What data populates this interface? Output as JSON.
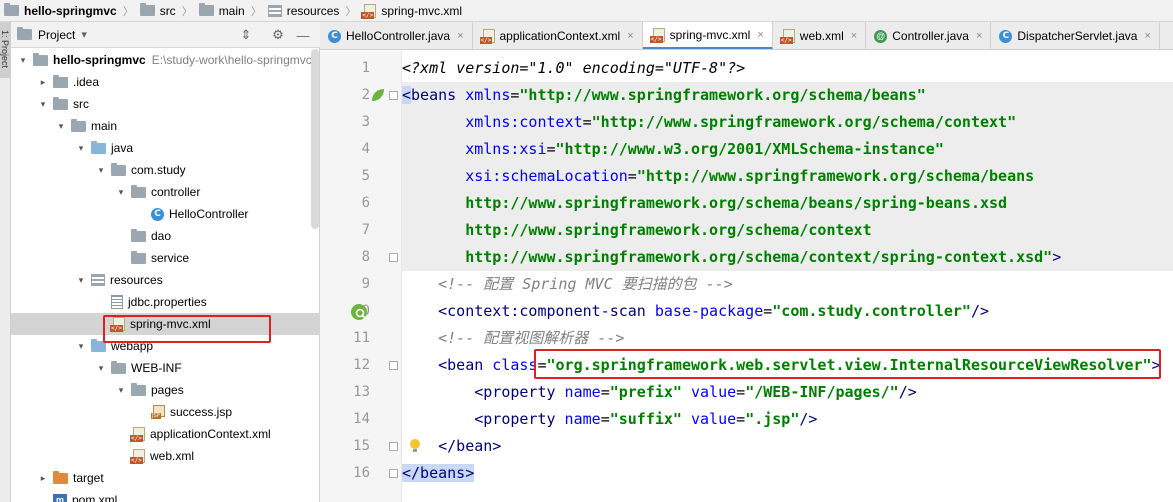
{
  "breadcrumb": [
    {
      "label": "hello-springmvc",
      "icon": "folder-icon"
    },
    {
      "label": "src",
      "icon": "folder-icon"
    },
    {
      "label": "main",
      "icon": "folder-icon"
    },
    {
      "label": "resources",
      "icon": "resources-folder-icon"
    },
    {
      "label": "spring-mvc.xml",
      "icon": "xml-file-icon"
    }
  ],
  "left_stripe": {
    "label": "1: Project"
  },
  "project_panel": {
    "title": "Project",
    "dropdown_glyph": "▾",
    "toolbar_glyphs": {
      "collapse": "⇕",
      "settings": "⚙",
      "hide": "—"
    },
    "tree": [
      {
        "label": "hello-springmvc",
        "path": "E:\\study-work\\hello-springmvc",
        "depth": 0,
        "arrow": "expanded",
        "icon": "module-folder-icon",
        "bold": true
      },
      {
        "label": ".idea",
        "depth": 1,
        "arrow": "collapsed",
        "icon": "folder-icon"
      },
      {
        "label": "src",
        "depth": 1,
        "arrow": "expanded",
        "icon": "folder-icon"
      },
      {
        "label": "main",
        "depth": 2,
        "arrow": "expanded",
        "icon": "folder-icon"
      },
      {
        "label": "java",
        "depth": 3,
        "arrow": "expanded",
        "icon": "source-folder-icon"
      },
      {
        "label": "com.study",
        "depth": 4,
        "arrow": "expanded",
        "icon": "package-icon"
      },
      {
        "label": "controller",
        "depth": 5,
        "arrow": "expanded",
        "icon": "package-icon"
      },
      {
        "label": "HelloController",
        "depth": 6,
        "arrow": "none",
        "icon": "java-class-icon"
      },
      {
        "label": "dao",
        "depth": 5,
        "arrow": "none",
        "icon": "package-icon"
      },
      {
        "label": "service",
        "depth": 5,
        "arrow": "none",
        "icon": "package-icon"
      },
      {
        "label": "resources",
        "depth": 3,
        "arrow": "expanded",
        "icon": "resources-folder-icon"
      },
      {
        "label": "jdbc.properties",
        "depth": 4,
        "arrow": "none",
        "icon": "properties-file-icon"
      },
      {
        "label": "spring-mvc.xml",
        "depth": 4,
        "arrow": "none",
        "icon": "xml-file-icon",
        "selected": true
      },
      {
        "label": "webapp",
        "depth": 3,
        "arrow": "expanded",
        "icon": "web-folder-icon"
      },
      {
        "label": "WEB-INF",
        "depth": 4,
        "arrow": "expanded",
        "icon": "folder-icon"
      },
      {
        "label": "pages",
        "depth": 5,
        "arrow": "expanded",
        "icon": "folder-icon"
      },
      {
        "label": "success.jsp",
        "depth": 6,
        "arrow": "none",
        "icon": "jsp-file-icon"
      },
      {
        "label": "applicationContext.xml",
        "depth": 5,
        "arrow": "none",
        "icon": "xml-file-icon"
      },
      {
        "label": "web.xml",
        "depth": 5,
        "arrow": "none",
        "icon": "xml-file-icon"
      },
      {
        "label": "target",
        "depth": 1,
        "arrow": "collapsed",
        "icon": "excluded-folder-icon"
      },
      {
        "label": "pom.xml",
        "depth": 1,
        "arrow": "none",
        "icon": "maven-file-icon"
      }
    ]
  },
  "tabs": [
    {
      "label": "HelloController.java",
      "icon": "java-class-icon",
      "active": false
    },
    {
      "label": "applicationContext.xml",
      "icon": "xml-file-icon",
      "active": false
    },
    {
      "label": "spring-mvc.xml",
      "icon": "xml-file-icon",
      "active": true
    },
    {
      "label": "web.xml",
      "icon": "xml-file-icon",
      "active": false
    },
    {
      "label": "Controller.java",
      "icon": "annotation-icon",
      "active": false
    },
    {
      "label": "DispatcherServlet.java",
      "icon": "java-class-icon",
      "active": false
    }
  ],
  "tab_close_glyph": "×",
  "code_lines": [
    {
      "n": "1",
      "tokens": [
        [
          "pi",
          "<?xml version=\"1.0\" encoding=\"UTF-8\"?>"
        ]
      ]
    },
    {
      "n": "2",
      "hl": true,
      "tokens": [
        [
          "tagsel",
          "<"
        ],
        [
          "tag",
          "beans"
        ],
        [
          "attr",
          " xmlns"
        ],
        [
          "plain",
          "="
        ],
        [
          "val",
          "\"http://www.springframework.org/schema/beans\""
        ]
      ]
    },
    {
      "n": "3",
      "hl": true,
      "tokens": [
        [
          "plain",
          "       "
        ],
        [
          "attr",
          "xmlns:context"
        ],
        [
          "plain",
          "="
        ],
        [
          "val",
          "\"http://www.springframework.org/schema/context\""
        ]
      ]
    },
    {
      "n": "4",
      "hl": true,
      "tokens": [
        [
          "plain",
          "       "
        ],
        [
          "attr",
          "xmlns:xsi"
        ],
        [
          "plain",
          "="
        ],
        [
          "val",
          "\"http://www.w3.org/2001/XMLSchema-instance\""
        ]
      ]
    },
    {
      "n": "5",
      "hl": true,
      "tokens": [
        [
          "plain",
          "       "
        ],
        [
          "attr",
          "xsi:schemaLocation"
        ],
        [
          "plain",
          "="
        ],
        [
          "val",
          "\"http://www.springframework.org/schema/beans"
        ]
      ]
    },
    {
      "n": "6",
      "hl": true,
      "tokens": [
        [
          "val",
          "       http://www.springframework.org/schema/beans/spring-beans.xsd"
        ]
      ]
    },
    {
      "n": "7",
      "hl": true,
      "tokens": [
        [
          "val",
          "       http://www.springframework.org/schema/context"
        ]
      ]
    },
    {
      "n": "8",
      "hl": true,
      "tokens": [
        [
          "val",
          "       http://www.springframework.org/schema/context/spring-context.xsd\""
        ],
        [
          "tag",
          ">"
        ]
      ]
    },
    {
      "n": "9",
      "tokens": [
        [
          "plain",
          "    "
        ],
        [
          "cmt",
          "<!-- 配置 Spring MVC 要扫描的包 -->"
        ]
      ]
    },
    {
      "n": "10",
      "tokens": [
        [
          "plain",
          "    "
        ],
        [
          "tag",
          "<context:component-scan"
        ],
        [
          "attr",
          " base-package"
        ],
        [
          "plain",
          "="
        ],
        [
          "val",
          "\"com.study.controller\""
        ],
        [
          "tag",
          "/>"
        ]
      ]
    },
    {
      "n": "11",
      "tokens": [
        [
          "plain",
          "    "
        ],
        [
          "cmt",
          "<!-- 配置视图解析器 -->"
        ]
      ]
    },
    {
      "n": "12",
      "tokens": [
        [
          "plain",
          "    "
        ],
        [
          "tag",
          "<bean"
        ],
        [
          "attr",
          " class"
        ],
        [
          "plain",
          "="
        ],
        [
          "val",
          "\"org.springframework.web.servlet.view.InternalResourceViewResolver\""
        ],
        [
          "tag",
          ">"
        ]
      ]
    },
    {
      "n": "13",
      "tokens": [
        [
          "plain",
          "        "
        ],
        [
          "tag",
          "<property"
        ],
        [
          "attr",
          " name"
        ],
        [
          "plain",
          "="
        ],
        [
          "val",
          "\"prefix\""
        ],
        [
          "attr",
          " value"
        ],
        [
          "plain",
          "="
        ],
        [
          "val",
          "\"/WEB-INF/pages/\""
        ],
        [
          "tag",
          "/>"
        ]
      ]
    },
    {
      "n": "14",
      "tokens": [
        [
          "plain",
          "        "
        ],
        [
          "tag",
          "<property"
        ],
        [
          "attr",
          " name"
        ],
        [
          "plain",
          "="
        ],
        [
          "val",
          "\"suffix\""
        ],
        [
          "attr",
          " value"
        ],
        [
          "plain",
          "="
        ],
        [
          "val",
          "\".jsp\""
        ],
        [
          "tag",
          "/>"
        ]
      ]
    },
    {
      "n": "15",
      "tokens": [
        [
          "plain",
          "    "
        ],
        [
          "tag",
          "</bean>"
        ]
      ]
    },
    {
      "n": "16",
      "tokens": [
        [
          "tagsel",
          "</beans>"
        ]
      ]
    }
  ],
  "colors": {
    "highlight_box": "#e02020",
    "active_tab_underline": "#4a88c7"
  }
}
